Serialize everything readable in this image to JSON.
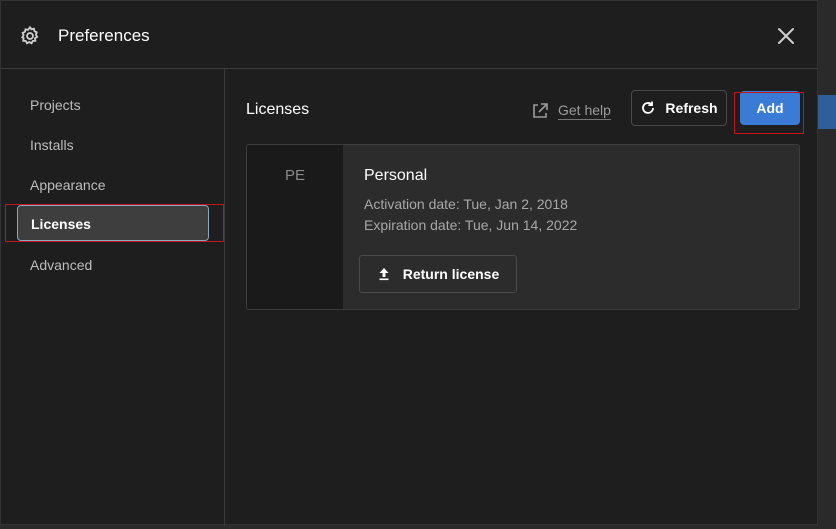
{
  "window": {
    "title": "Preferences",
    "icons": {
      "settings": "gear-icon",
      "close": "close-icon"
    }
  },
  "sidebar": {
    "items": [
      {
        "label": "Projects"
      },
      {
        "label": "Installs"
      },
      {
        "label": "Appearance"
      },
      {
        "label": "Licenses",
        "active": true
      },
      {
        "label": "Advanced"
      }
    ]
  },
  "licenses": {
    "section_title": "Licenses",
    "help_label": "Get help",
    "refresh_label": "Refresh",
    "add_label": "Add",
    "card": {
      "abbr": "PE",
      "name": "Personal",
      "activation": "Activation date: Tue, Jan 2, 2018",
      "expiration": "Expiration date: Tue, Jun 14, 2022",
      "return_label": "Return license"
    }
  },
  "colors": {
    "accent": "#3a7bd5",
    "highlight": "#c4141a",
    "background": "#1e1e1e"
  }
}
